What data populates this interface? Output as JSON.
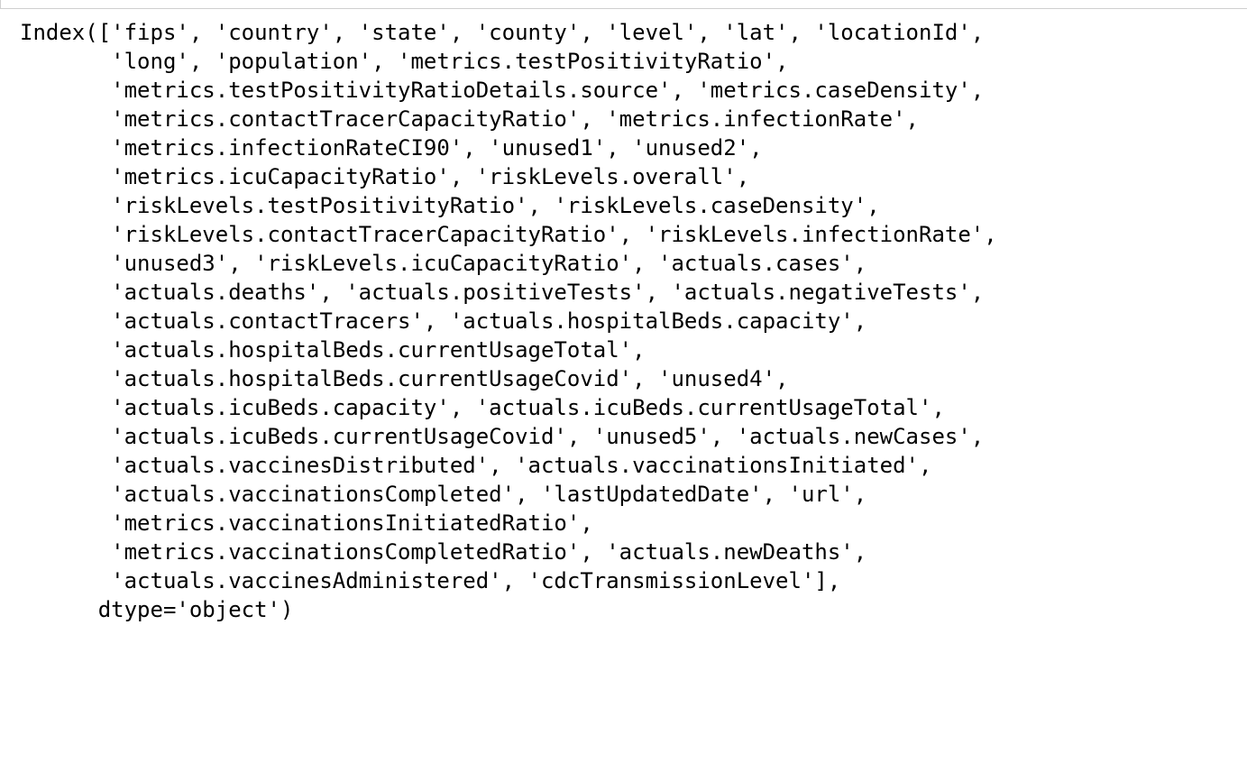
{
  "output": {
    "lines": [
      "Index(['fips', 'country', 'state', 'county', 'level', 'lat', 'locationId',",
      "       'long', 'population', 'metrics.testPositivityRatio',",
      "       'metrics.testPositivityRatioDetails.source', 'metrics.caseDensity',",
      "       'metrics.contactTracerCapacityRatio', 'metrics.infectionRate',",
      "       'metrics.infectionRateCI90', 'unused1', 'unused2',",
      "       'metrics.icuCapacityRatio', 'riskLevels.overall',",
      "       'riskLevels.testPositivityRatio', 'riskLevels.caseDensity',",
      "       'riskLevels.contactTracerCapacityRatio', 'riskLevels.infectionRate',",
      "       'unused3', 'riskLevels.icuCapacityRatio', 'actuals.cases',",
      "       'actuals.deaths', 'actuals.positiveTests', 'actuals.negativeTests',",
      "       'actuals.contactTracers', 'actuals.hospitalBeds.capacity',",
      "       'actuals.hospitalBeds.currentUsageTotal',",
      "       'actuals.hospitalBeds.currentUsageCovid', 'unused4',",
      "       'actuals.icuBeds.capacity', 'actuals.icuBeds.currentUsageTotal',",
      "       'actuals.icuBeds.currentUsageCovid', 'unused5', 'actuals.newCases',",
      "       'actuals.vaccinesDistributed', 'actuals.vaccinationsInitiated',",
      "       'actuals.vaccinationsCompleted', 'lastUpdatedDate', 'url',",
      "       'metrics.vaccinationsInitiatedRatio',",
      "       'metrics.vaccinationsCompletedRatio', 'actuals.newDeaths',",
      "       'actuals.vaccinesAdministered', 'cdcTransmissionLevel'],",
      "      dtype='object')"
    ]
  }
}
